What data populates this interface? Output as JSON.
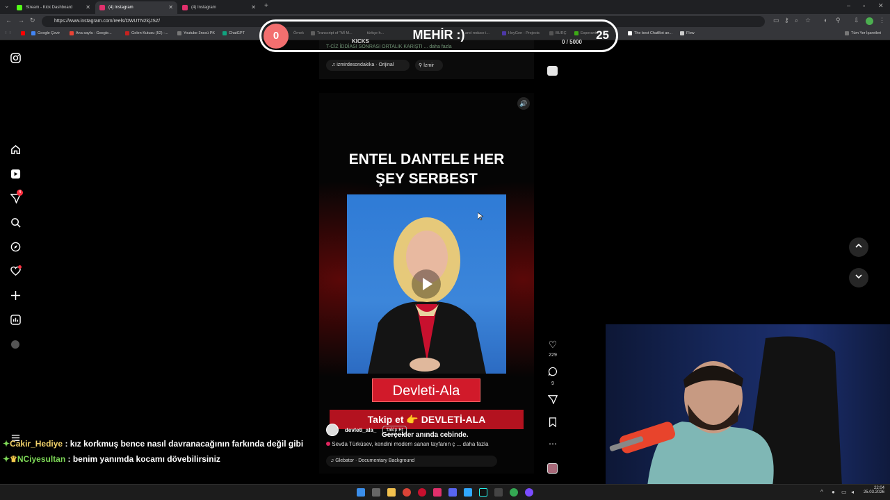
{
  "browser": {
    "tabs": [
      {
        "label": "Stream - Kick Dashboard",
        "color": "#53fc18"
      },
      {
        "label": "(4) Instagram",
        "color": "#e1306c"
      },
      {
        "label": "(4) Instagram",
        "color": "#e1306c"
      }
    ],
    "new_tab": "+",
    "url": "https://www.instagram.com/reels/DWUTN2kjJSZ/",
    "bookmarks": [
      "Google Çevir",
      "Ana sayfa - Google...",
      "Gelen Kutusu (52) -...",
      "Youtube 3nccü PK",
      "ChatGPT",
      "Örnek",
      "Transcript of \"Mİ M...",
      "türkçe h...",
      "and reduce i...",
      "HeyGen - Projects",
      "BURÇ",
      "Esperanto",
      "The best ChatBot an...",
      "Flow"
    ],
    "all_bookmarks": "Tüm Yer İşaretleri"
  },
  "overlay": {
    "count": "0",
    "title": "MEHİR :)",
    "total": "25",
    "label": "KICKS",
    "progress": "0  / 5000",
    "accent": "#f36f6f"
  },
  "prev_post": {
    "caption": "T-CİZ İDDİASI SONRASI ORTALIK KARIŞTI ... daha fazla",
    "audio": "izmirdesondakika · Orijinal",
    "location": "İzmir"
  },
  "reel": {
    "headline_line1": "ENTEL DANTELE HER",
    "headline_line2": "ŞEY SERBEST",
    "name_plate": "Devleti-Ala",
    "follow_banner": "Takip et 👉 DEVLETİ-ALA",
    "username": "devleti_ala_",
    "follow": "Takip Et",
    "subtitle": "Gerçekler anında cebinde.",
    "caption": "Sevda Türküsev, kendini modern sanan tayfanın ç ... daha fazla",
    "audio": "Glebator · Documentary Background"
  },
  "actions": {
    "likes": "229",
    "comments": "9"
  },
  "chat": [
    {
      "user": "Cakir_Hediye",
      "user_color": "#f3d36b",
      "message": " : kız korkmuş bence nasıl davranacağının farkında değil gibi"
    },
    {
      "user": "NCiyesultan",
      "user_color": "#7ed957",
      "message": " : benim yanımda kocamı dövebilirsiniz"
    }
  ],
  "taskbar": {
    "time": "22:04",
    "date": "25.03.2026"
  }
}
